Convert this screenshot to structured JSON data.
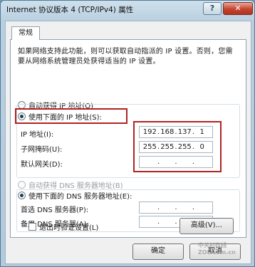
{
  "window": {
    "title": "Internet 协议版本 4 (TCP/IPv4) 属性",
    "help_label": "?",
    "close_label": "✕"
  },
  "tabs": [
    {
      "label": "常规"
    }
  ],
  "description": "如果网络支持此功能，则可以获取自动指派的 IP 设置。否则，您需要从网络系统管理员处获得适当的 IP 设置。",
  "ip_group": {
    "auto_label": "自动获得 IP 地址(O)",
    "manual_label": "使用下面的 IP 地址(S):",
    "selected": "manual",
    "fields": [
      {
        "label": "IP 地址(I):",
        "octets": [
          "192",
          "168",
          "137",
          "1"
        ]
      },
      {
        "label": "子网掩码(U):",
        "octets": [
          "255",
          "255",
          "255",
          "0"
        ]
      },
      {
        "label": "默认网关(D):",
        "octets": [
          "",
          "",
          "",
          ""
        ]
      }
    ]
  },
  "dns_group": {
    "auto_label": "自动获得 DNS 服务器地址(B)",
    "manual_label": "使用下面的 DNS 服务器地址(E):",
    "selected": "manual",
    "fields": [
      {
        "label": "首选 DNS 服务器(P):",
        "octets": [
          "",
          "",
          "",
          ""
        ]
      },
      {
        "label": "备用 DNS 服务器(A):",
        "octets": [
          "",
          "",
          "",
          ""
        ]
      }
    ]
  },
  "validate_on_exit": {
    "label": "退出时验证设置(L)",
    "checked": false
  },
  "buttons": {
    "advanced": "高级(V)...",
    "ok": "确定",
    "cancel": "取消"
  },
  "watermark": "中关村在线 ZOL.com.cn",
  "colors": {
    "highlight_box": "#b22222",
    "title_bar": "#b7cfe0"
  }
}
